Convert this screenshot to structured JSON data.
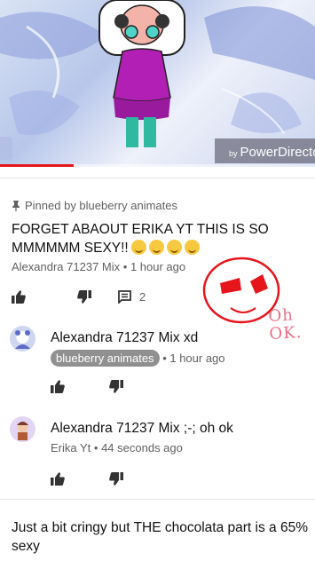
{
  "video": {
    "watermark_prefix": "by",
    "watermark_brand": "PowerDirecto",
    "progress_fraction": 0.235
  },
  "pinned_comment": {
    "pinned_label": "Pinned by blueberry animates",
    "text": "FORGET ABAOUT ERIKA YT THIS IS SO MMMMMM SEXY!!",
    "emojis": [
      "unamused-face",
      "unamused-face",
      "unamused-face",
      "tears-of-joy-face"
    ],
    "author": "Alexandra 71237 Mix",
    "time": "1 hour ago",
    "reply_count": "2"
  },
  "handwriting": {
    "line1": "Oh",
    "line2": "OK."
  },
  "replies": [
    {
      "text": "Alexandra 71237 Mix xd",
      "author": "blueberry animates",
      "author_style": "chip",
      "time": "1 hour ago"
    },
    {
      "text": "Alexandra 71237 Mix ;-; oh ok",
      "author": "Erika Yt",
      "time": "44 seconds ago"
    }
  ],
  "next_comment": {
    "text": "Just a bit cringy but THE chocolata part is a 65% sexy"
  },
  "colors": {
    "progress": "#e4181b",
    "meta_text": "#606060",
    "chip_bg": "#909090",
    "doodle_red": "#e6141b",
    "handwriting_pink": "#e8718a"
  },
  "icons": {
    "like": "thumbs-up-icon",
    "dislike": "thumbs-down-icon",
    "reply": "comment-icon",
    "pin": "pin-icon"
  }
}
